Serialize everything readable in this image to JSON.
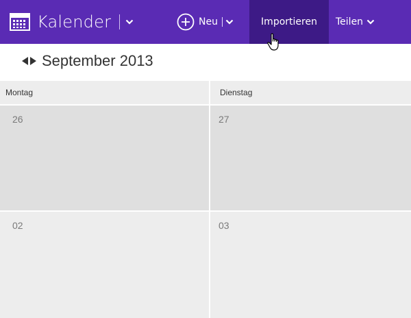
{
  "app": {
    "title": "Kalender"
  },
  "toolbar": {
    "new_label": "Neu",
    "import_label": "Importieren",
    "share_label": "Teilen"
  },
  "calendar": {
    "month_title": "September 2013",
    "weekdays": [
      "Montag",
      "Dienstag"
    ],
    "weeks": [
      [
        "26",
        "27"
      ],
      [
        "02",
        "03"
      ]
    ]
  },
  "colors": {
    "topbar": "#5a2bb4",
    "active_command": "#3d1a86",
    "header_bg": "#ededed",
    "prev_month_cell": "#dfdfdf",
    "current_month_cell": "#ededed"
  }
}
